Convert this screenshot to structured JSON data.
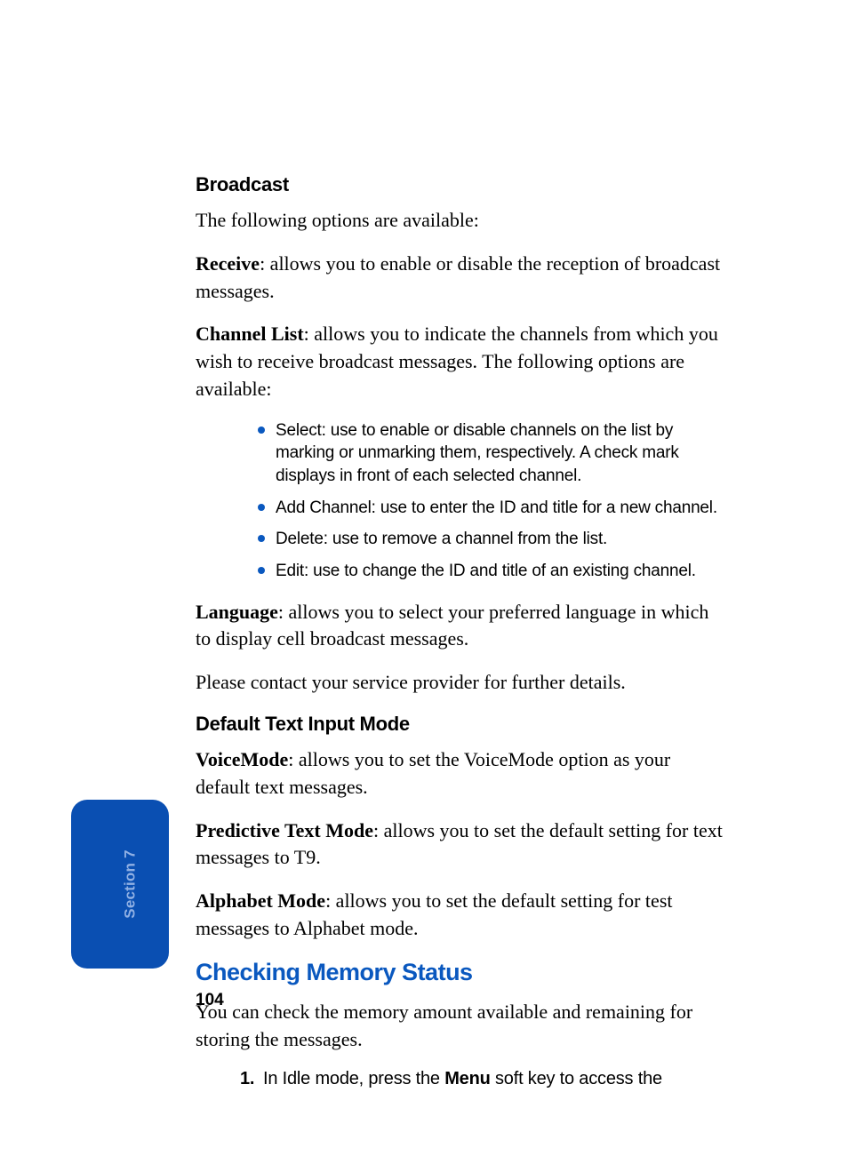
{
  "broadcast": {
    "heading": "Broadcast",
    "intro": "The following options are available:",
    "receive_label": "Receive",
    "receive_text": ": allows you to enable or disable the reception of broadcast messages.",
    "channel_label": "Channel List",
    "channel_text": ": allows you to indicate the channels from which you wish to receive broadcast messages. The following options are available:",
    "bullets": [
      "Select: use to enable or disable channels on the list by marking or unmarking them, respectively. A check mark displays in front of each selected channel.",
      "Add Channel: use to enter the ID and title for a new channel.",
      "Delete: use to remove a channel from the list.",
      "Edit: use to change the ID and title of an existing channel."
    ],
    "language_label": "Language",
    "language_text": ": allows you to select your preferred language in which to display cell broadcast messages.",
    "contact": "Please contact your service provider for further details."
  },
  "default_input": {
    "heading": "Default Text Input Mode",
    "voice_label": "VoiceMode",
    "voice_text": ": allows you to set the VoiceMode option as your default text messages.",
    "predictive_label": "Predictive Text Mode",
    "predictive_text": ":  allows you to set the default setting for text messages to T9.",
    "alphabet_label": "Alphabet Mode",
    "alphabet_text": ": allows you to set the default setting for test messages to Alphabet mode."
  },
  "memory": {
    "title": "Checking Memory Status",
    "intro": "You can check the memory amount available and remaining for storing the messages.",
    "step_num": "1.",
    "step_pre": "In Idle mode, press the ",
    "step_bold": "Menu",
    "step_post": " soft key to access the"
  },
  "side_tab": "Section 7",
  "page_number": "104"
}
